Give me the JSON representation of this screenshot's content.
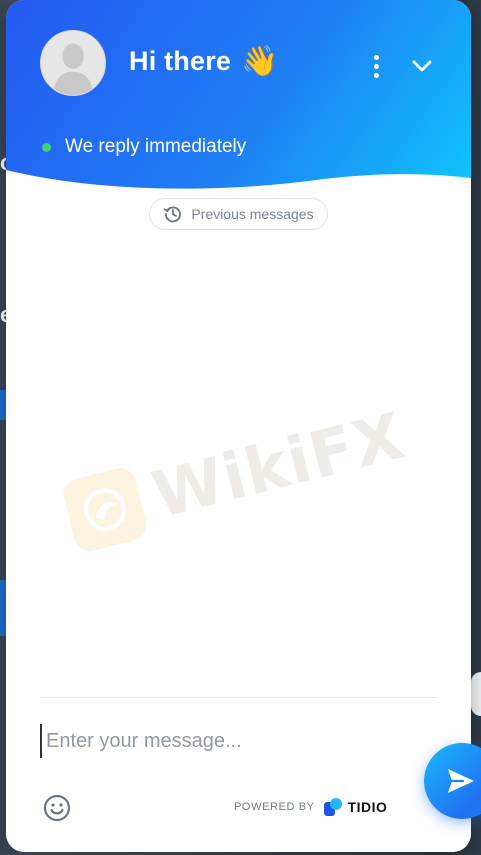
{
  "header": {
    "title": "Hi there",
    "wave_emoji": "👋",
    "status_text": "We reply immediately",
    "status_color": "#43d26d",
    "gradient": [
      "#2459f2",
      "#0fc5fb"
    ]
  },
  "icons": {
    "avatar": "avatar-placeholder-icon",
    "menu": "more-vertical-icon",
    "collapse": "chevron-down-icon",
    "history": "history-icon",
    "emoji": "smiley-icon",
    "send": "send-icon"
  },
  "conversation": {
    "previous_label": "Previous messages"
  },
  "composer": {
    "placeholder": "Enter your message..."
  },
  "footer": {
    "powered_by": "POWERED BY",
    "brand": "TIDIO"
  },
  "watermark": {
    "text": "WikiFX"
  },
  "background": {
    "partial_letters": [
      "c",
      "e"
    ]
  }
}
